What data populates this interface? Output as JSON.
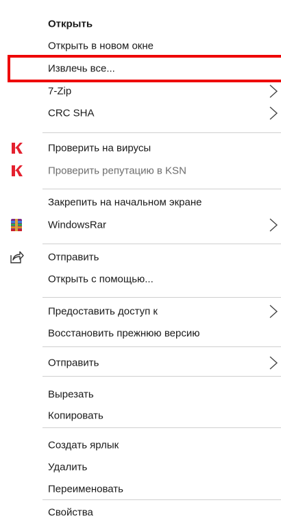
{
  "menu": {
    "open": "Открыть",
    "open_new_window": "Открыть в новом окне",
    "extract_all": "Извлечь все...",
    "seven_zip": "7-Zip",
    "crc_sha": "CRC SHA",
    "check_viruses": "Проверить на вирусы",
    "check_reputation": "Проверить репутацию в KSN",
    "pin_start": "Закрепить на начальном экране",
    "windowsrar": "WindowsRar",
    "send_share": "Отправить",
    "open_with": "Открыть с помощью...",
    "give_access": "Предоставить доступ к",
    "restore_version": "Восстановить прежнюю версию",
    "send_to": "Отправить",
    "cut": "Вырезать",
    "copy": "Копировать",
    "create_shortcut": "Создать ярлык",
    "delete": "Удалить",
    "rename": "Переименовать",
    "properties": "Свойства"
  },
  "icons": {
    "kaspersky": "kaspersky-icon",
    "winrar": "winrar-icon",
    "share": "share-icon",
    "submenu": "chevron-right-icon"
  },
  "colors": {
    "highlight_border": "#ee0000",
    "kaspersky_red": "#e4202e",
    "separator": "#cfcfcf"
  }
}
